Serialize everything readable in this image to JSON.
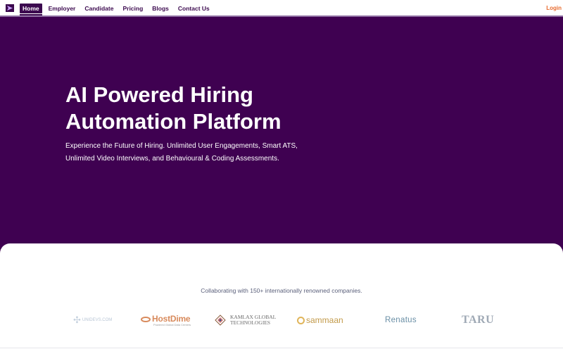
{
  "nav": {
    "items": [
      {
        "label": "Home",
        "active": true
      },
      {
        "label": "Employer",
        "active": false
      },
      {
        "label": "Candidate",
        "active": false
      },
      {
        "label": "Pricing",
        "active": false
      },
      {
        "label": "Blogs",
        "active": false
      },
      {
        "label": "Contact Us",
        "active": false
      }
    ],
    "login_label": "Login"
  },
  "hero": {
    "title_line1": "AI Powered Hiring",
    "title_line2": "Automation Platform",
    "subtitle_line1": "Experience the Future of Hiring. Unlimited User Engagements, Smart ATS,",
    "subtitle_line2": "Unlimited Video Interviews, and Behavioural & Coding Assessments."
  },
  "partners": {
    "heading": "Collaborating with 150+ internationally renowned companies.",
    "companies": [
      {
        "name": "UNIDEVS.COM"
      },
      {
        "name": "HostDime",
        "tagline": "Powered Global Data Centers"
      },
      {
        "name_line1": "KAMLAX GLOBAL",
        "name_line2": "TECHNOLOGIES"
      },
      {
        "name": "sammaan"
      },
      {
        "name": "Renatus"
      },
      {
        "name": "TARU"
      }
    ]
  },
  "colors": {
    "brand_purple": "#3f0151",
    "login_orange": "#e86b2e"
  }
}
